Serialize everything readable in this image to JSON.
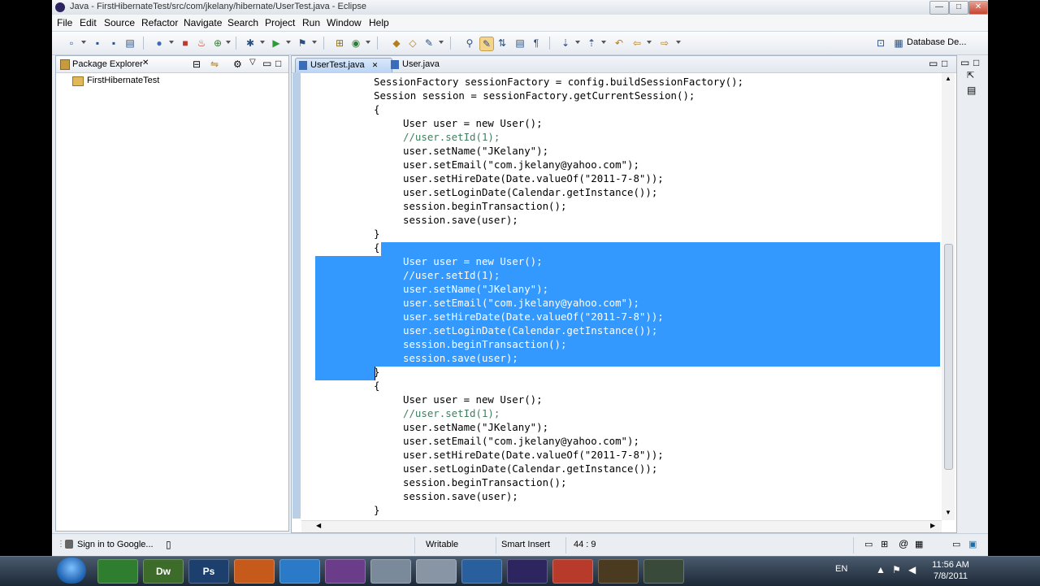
{
  "window": {
    "title": "Java - FirstHibernateTest/src/com/jkelany/hibernate/UserTest.java - Eclipse",
    "controls": [
      "—",
      "□",
      "✕"
    ]
  },
  "menubar": [
    "File",
    "Edit",
    "Source",
    "Refactor",
    "Navigate",
    "Search",
    "Project",
    "Run",
    "Window",
    "Help"
  ],
  "toolbar": {
    "perspective_label": "Database De..."
  },
  "package_explorer": {
    "title": "Package Explorer",
    "close": "✕",
    "items": [
      "FirstHibernateTest"
    ]
  },
  "editor": {
    "tabs": [
      {
        "label": "UserTest.java",
        "active": true,
        "close": "✕"
      },
      {
        "label": "User.java",
        "active": false
      }
    ],
    "lines": [
      {
        "text": "SessionFactory sessionFactory = config.buildSessionFactory();"
      },
      {
        "text": "Session session = sessionFactory.getCurrentSession();"
      },
      {
        "text": "{"
      },
      {
        "text": "User user = new User();"
      },
      {
        "text": "//user.setId(1);"
      },
      {
        "text": "user.setName(\"JKelany\");"
      },
      {
        "text": "user.setEmail(\"com.jkelany@yahoo.com\");"
      },
      {
        "text": "user.setHireDate(Date.valueOf(\"2011-7-8\"));"
      },
      {
        "text": "user.setLoginDate(Calendar.getInstance());"
      },
      {
        "text": "session.beginTransaction();"
      },
      {
        "text": "session.save(user);"
      },
      {
        "text": "}"
      },
      {
        "text": "{"
      },
      {
        "text": "User user = new User();"
      },
      {
        "text": "//user.setId(1);"
      },
      {
        "text": "user.setName(\"JKelany\");"
      },
      {
        "text": "user.setEmail(\"com.jkelany@yahoo.com\");"
      },
      {
        "text": "user.setHireDate(Date.valueOf(\"2011-7-8\"));"
      },
      {
        "text": "user.setLoginDate(Calendar.getInstance());"
      },
      {
        "text": "session.beginTransaction();"
      },
      {
        "text": "session.save(user);"
      },
      {
        "text": "}"
      },
      {
        "text": "{"
      },
      {
        "text": "User user = new User();"
      },
      {
        "text": "//user.setId(1);"
      },
      {
        "text": "user.setName(\"JKelany\");"
      },
      {
        "text": "user.setEmail(\"com.jkelany@yahoo.com\");"
      },
      {
        "text": "user.setHireDate(Date.valueOf(\"2011-7-8\"));"
      },
      {
        "text": "user.setLoginDate(Calendar.getInstance());"
      },
      {
        "text": "session.beginTransaction();"
      },
      {
        "text": "session.save(user);"
      },
      {
        "text": "}"
      }
    ]
  },
  "status_bar": {
    "sign_in": "Sign in to Google...",
    "writable": "Writable",
    "insert_mode": "Smart Insert",
    "cursor_position": "44 : 9"
  },
  "taskbar": {
    "apps": [
      "Dw",
      "Ps"
    ],
    "language": "EN",
    "time": "11:56 AM",
    "date": "7/8/2011"
  },
  "colors": {
    "selection": "#3399ff",
    "keyword": "#7f0055",
    "string": "#2a00ff",
    "comment": "#3f7f5f"
  }
}
